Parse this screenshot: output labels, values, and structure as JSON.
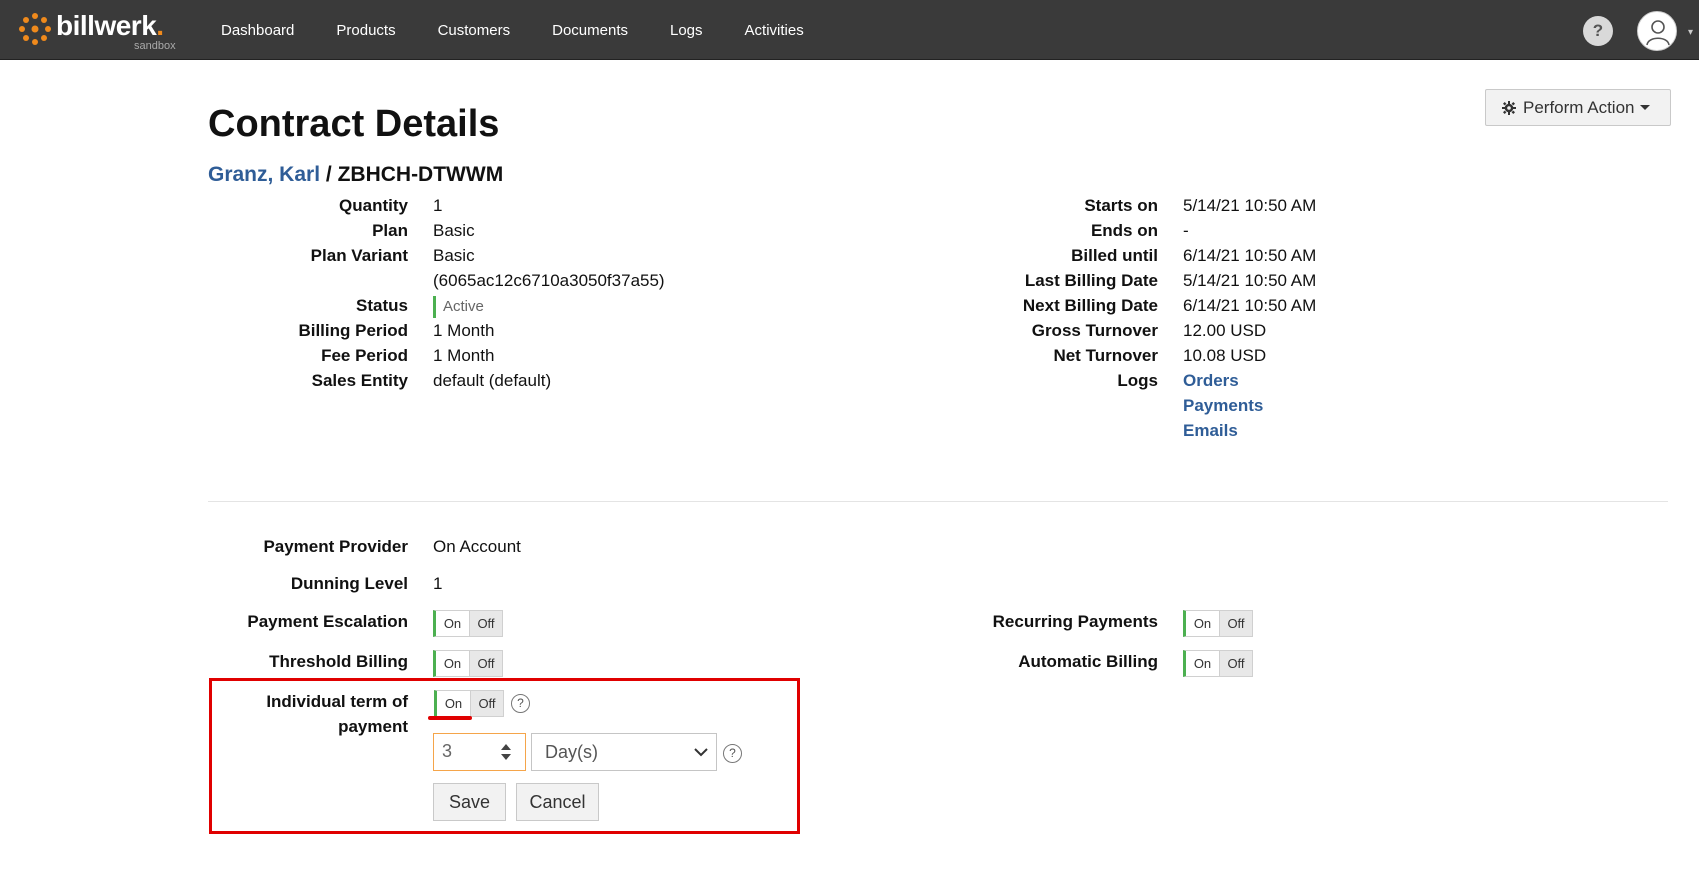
{
  "app": {
    "logo_text": "billwerk",
    "logo_sub": "sandbox",
    "nav": [
      "Dashboard",
      "Products",
      "Customers",
      "Documents",
      "Logs",
      "Activities"
    ],
    "help_label": "?"
  },
  "actions": {
    "perform": "Perform Action"
  },
  "page": {
    "title": "Contract Details",
    "customer": "Granz, Karl",
    "separator": "/",
    "contract_id": "ZBHCH-DTWWM"
  },
  "left_details": [
    {
      "label": "Quantity",
      "value": "1"
    },
    {
      "label": "Plan",
      "value": "Basic"
    },
    {
      "label": "Plan Variant",
      "value": "Basic"
    },
    {
      "label": "",
      "value": "(6065ac12c6710a3050f37a55)"
    },
    {
      "label": "Status",
      "value": "Active"
    },
    {
      "label": "Billing Period",
      "value": "1 Month"
    },
    {
      "label": "Fee Period",
      "value": "1 Month"
    },
    {
      "label": "Sales Entity",
      "value": "default (default)"
    }
  ],
  "right_details": [
    {
      "label": "Starts on",
      "value": "5/14/21 10:50 AM"
    },
    {
      "label": "Ends on",
      "value": "-"
    },
    {
      "label": "Billed until",
      "value": "6/14/21 10:50 AM"
    },
    {
      "label": "Last Billing Date",
      "value": "5/14/21 10:50 AM"
    },
    {
      "label": "Next Billing Date",
      "value": "6/14/21 10:50 AM"
    },
    {
      "label": "Gross Turnover",
      "value": "12.00 USD"
    },
    {
      "label": "Net Turnover",
      "value": "10.08 USD"
    },
    {
      "label": "Logs",
      "value": ""
    }
  ],
  "logs_links": [
    "Orders",
    "Payments",
    "Emails"
  ],
  "settings": {
    "payment_provider": {
      "label": "Payment Provider",
      "value": "On Account"
    },
    "dunning_level": {
      "label": "Dunning Level",
      "value": "1"
    },
    "payment_escalation": {
      "label": "Payment Escalation",
      "state": "On"
    },
    "threshold_billing": {
      "label": "Threshold Billing",
      "state": "On"
    },
    "recurring_payments": {
      "label": "Recurring Payments",
      "state": "On"
    },
    "automatic_billing": {
      "label": "Automatic Billing",
      "state": "On"
    },
    "individual_term": {
      "label_line1": "Individual term of",
      "label_line2": "payment",
      "state": "On"
    }
  },
  "toggle_labels": {
    "on": "On",
    "off": "Off"
  },
  "term": {
    "value": "3",
    "unit": "Day(s)"
  },
  "buttons": {
    "save": "Save",
    "cancel": "Cancel"
  },
  "colors": {
    "accent": "#4cb050",
    "link": "#2f5d97",
    "highlight": "#e00000",
    "input_focus": "#f5a54a",
    "logo": "#f08a1c"
  }
}
